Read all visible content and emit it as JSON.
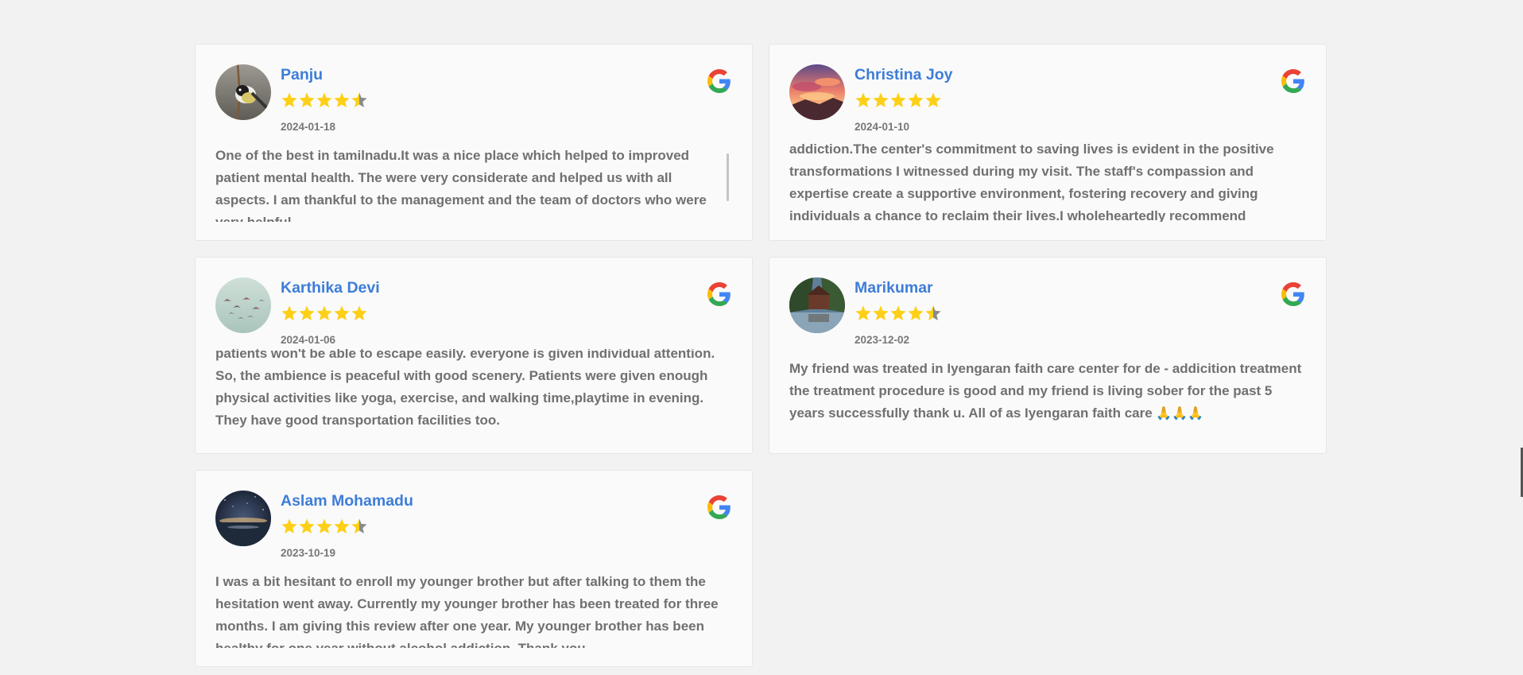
{
  "reviews": [
    {
      "name": "Panju",
      "rating": 4.5,
      "date": "2024-01-18",
      "text": "One of the best in tamilnadu.It was a nice place which helped to improved patient mental health. The were very considerate and helped us with all aspects. I am thankful to the management and the team of doctors who were very helpful."
    },
    {
      "name": "Christina Joy",
      "rating": 5,
      "date": "2024-01-10",
      "text": "addiction.The center's commitment to saving lives is evident in the positive transformations I witnessed during my visit. The staff's compassion and expertise create a supportive environment, fostering recovery and giving individuals a chance to reclaim their lives.I wholeheartedly recommend"
    },
    {
      "name": "Karthika Devi",
      "rating": 5,
      "date": "2024-01-06",
      "text": "patients won't be able to escape easily. everyone is given individual attention. So, the ambience is peaceful with good scenery. Patients were given enough physical activities like yoga, exercise, and walking time,playtime in evening. They have good transportation facilities too."
    },
    {
      "name": "Marikumar",
      "rating": 4.5,
      "date": "2023-12-02",
      "text": "My friend was treated in Iyengaran faith care center for de - addicition treatment the treatment procedure is good and my friend is living sober for the past 5 years successfully thank u. All of as Iyengaran faith care",
      "emoji": "🙏🙏🙏"
    },
    {
      "name": "Aslam Mohamadu",
      "rating": 4.5,
      "date": "2023-10-19",
      "text": "I was a bit hesitant to enroll my younger brother but after talking to them the hesitation went away. Currently my younger brother has been treated for three months. I am giving this review after one year. My younger brother has been healthy for one year without alcohol addiction. Thank you."
    }
  ],
  "colors": {
    "name": "#3d7dd8",
    "star_fill": "#fdd017",
    "star_empty": "#8a8a8a",
    "text": "#707070",
    "date": "#777777",
    "background": "#f2f2f2",
    "card": "#fafafa"
  },
  "icons": {
    "source": "google-icon",
    "rating": "star-icon"
  }
}
